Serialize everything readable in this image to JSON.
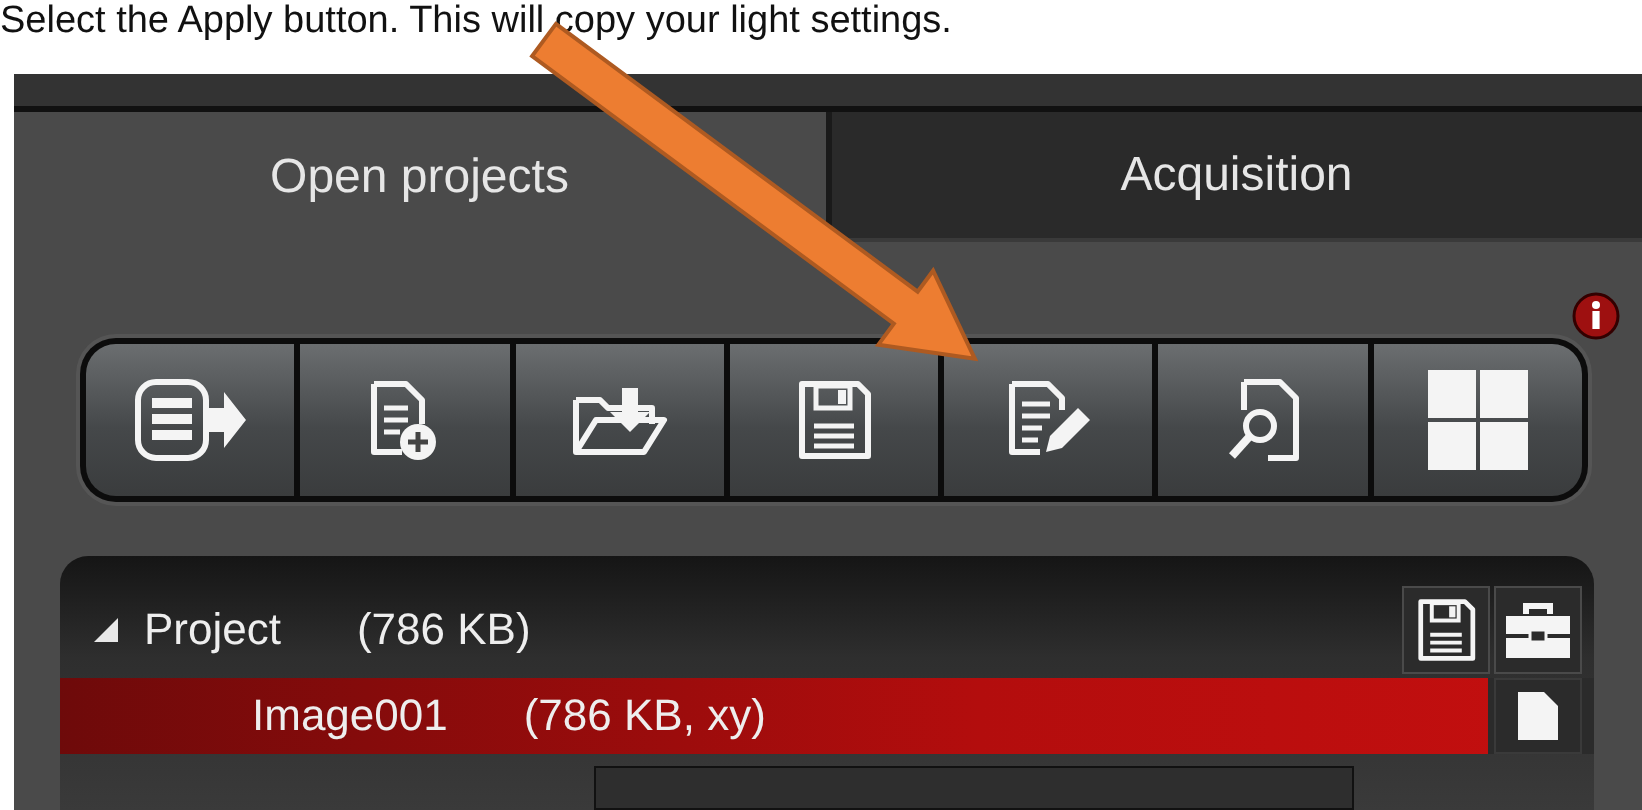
{
  "caption": "Select the Apply button.  This will copy your light settings.",
  "tabs": [
    {
      "label": "Open projects",
      "selected": true
    },
    {
      "label": "Acquisition",
      "selected": false
    }
  ],
  "tree": {
    "name": "Project",
    "size": "(786 KB)",
    "expanded": true,
    "children": [
      {
        "name": "Image001",
        "size": "(786 KB, xy)",
        "selected": true
      }
    ]
  }
}
